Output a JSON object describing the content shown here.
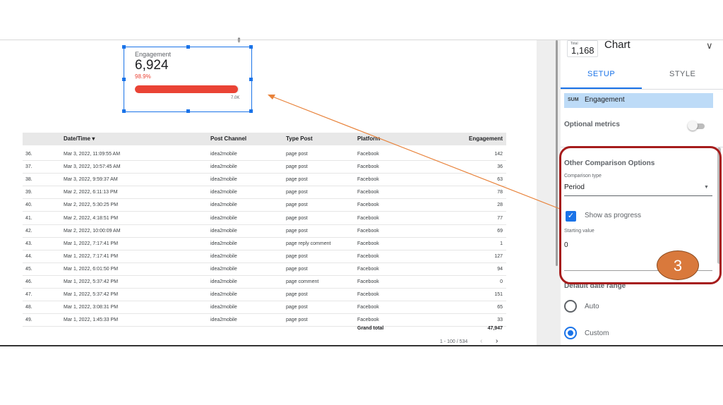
{
  "scorecard": {
    "title": "Engagement",
    "value": "6,924",
    "percent": "98.9%",
    "progress_fraction": 0.989,
    "max_label": "7.0K"
  },
  "table": {
    "headers": {
      "datetime": "Date/Time",
      "sort_indicator": "▾",
      "post_channel": "Post Channel",
      "type_post": "Type Post",
      "platform": "Platform",
      "engagement": "Engagement"
    },
    "rows": [
      {
        "idx": "36.",
        "datetime": "Mar 3, 2022, 11:09:55 AM",
        "channel": "idea2mobile",
        "type": "page post",
        "platform": "Facebook",
        "engagement": "142"
      },
      {
        "idx": "37.",
        "datetime": "Mar 3, 2022, 10:57:45 AM",
        "channel": "idea2mobile",
        "type": "page post",
        "platform": "Facebook",
        "engagement": "36"
      },
      {
        "idx": "38.",
        "datetime": "Mar 3, 2022, 9:59:37 AM",
        "channel": "idea2mobile",
        "type": "page post",
        "platform": "Facebook",
        "engagement": "63"
      },
      {
        "idx": "39.",
        "datetime": "Mar 2, 2022, 6:11:13 PM",
        "channel": "idea2mobile",
        "type": "page post",
        "platform": "Facebook",
        "engagement": "78"
      },
      {
        "idx": "40.",
        "datetime": "Mar 2, 2022, 5:30:25 PM",
        "channel": "idea2mobile",
        "type": "page post",
        "platform": "Facebook",
        "engagement": "28"
      },
      {
        "idx": "41.",
        "datetime": "Mar 2, 2022, 4:18:51 PM",
        "channel": "idea2mobile",
        "type": "page post",
        "platform": "Facebook",
        "engagement": "77"
      },
      {
        "idx": "42.",
        "datetime": "Mar 2, 2022, 10:00:09 AM",
        "channel": "idea2mobile",
        "type": "page post",
        "platform": "Facebook",
        "engagement": "69"
      },
      {
        "idx": "43.",
        "datetime": "Mar 1, 2022, 7:17:41 PM",
        "channel": "idea2mobile",
        "type": "page reply comment",
        "platform": "Facebook",
        "engagement": "1"
      },
      {
        "idx": "44.",
        "datetime": "Mar 1, 2022, 7:17:41 PM",
        "channel": "idea2mobile",
        "type": "page post",
        "platform": "Facebook",
        "engagement": "127"
      },
      {
        "idx": "45.",
        "datetime": "Mar 1, 2022, 6:01:50 PM",
        "channel": "idea2mobile",
        "type": "page post",
        "platform": "Facebook",
        "engagement": "94"
      },
      {
        "idx": "46.",
        "datetime": "Mar 1, 2022, 5:37:42 PM",
        "channel": "idea2mobile",
        "type": "page comment",
        "platform": "Facebook",
        "engagement": "0"
      },
      {
        "idx": "47.",
        "datetime": "Mar 1, 2022, 5:37:42 PM",
        "channel": "idea2mobile",
        "type": "page post",
        "platform": "Facebook",
        "engagement": "151"
      },
      {
        "idx": "48.",
        "datetime": "Mar 1, 2022, 3:08:31 PM",
        "channel": "idea2mobile",
        "type": "page post",
        "platform": "Facebook",
        "engagement": "65"
      },
      {
        "idx": "49.",
        "datetime": "Mar 1, 2022, 1:45:33 PM",
        "channel": "idea2mobile",
        "type": "page post",
        "platform": "Facebook",
        "engagement": "33"
      }
    ],
    "grand_total_label": "Grand total",
    "grand_total_value": "47,947",
    "pagination": "1 - 100 / 534",
    "prev_glyph": "‹",
    "next_glyph": "›"
  },
  "panel": {
    "chip_total_label": "Total",
    "chip_value": "1,168",
    "chart_title": "Chart",
    "chevron_glyph": "∨",
    "tabs": {
      "setup": "SETUP",
      "style": "STYLE"
    },
    "metric": {
      "agg": "SUM",
      "name": "Engagement"
    },
    "optional_metrics_label": "Optional metrics",
    "other_comparison_title": "Other Comparison Options",
    "comparison_type_label": "Comparison type",
    "comparison_type_value": "Period",
    "dropdown_glyph": "▼",
    "checkbox_glyph": "✓",
    "show_as_progress_label": "Show as progress",
    "starting_value_label": "Starting value",
    "starting_value": "0",
    "default_date_range_title": "Default date range",
    "radio_auto_label": "Auto",
    "radio_custom_label": "Custom"
  },
  "annotation": {
    "badge_number": "3",
    "highlight_color": "#a61c1c",
    "badge_color": "#d9793c",
    "arrow_color": "#e8823a"
  },
  "colors": {
    "accent": "#1a73e8",
    "progress": "#ea4335",
    "metric_chip": "#bddbf7"
  }
}
